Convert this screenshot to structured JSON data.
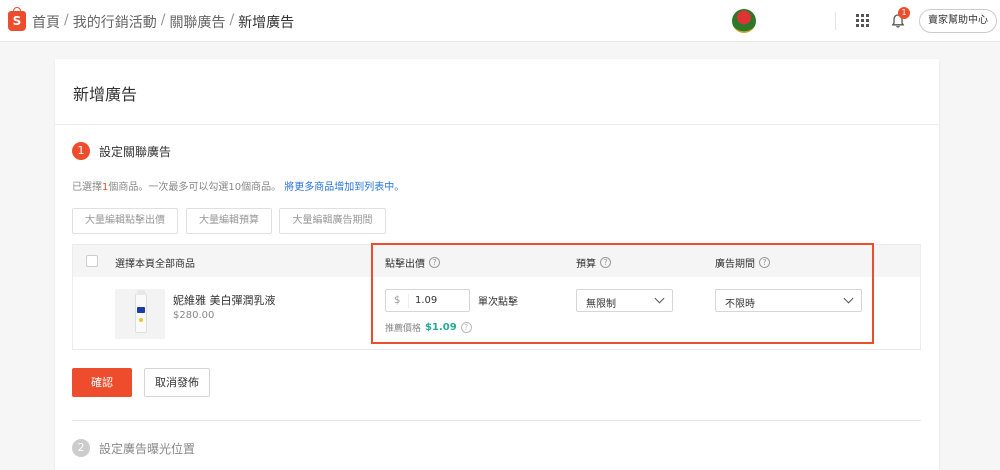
{
  "topbar": {
    "logo_letter": "S",
    "breadcrumb": [
      "首頁",
      "我的行銷活動",
      "關聯廣告",
      "新增廣告"
    ],
    "separator": "/",
    "notification_count": "1",
    "help_label": "賣家幫助中心"
  },
  "page": {
    "title": "新增廣告"
  },
  "step1": {
    "number": "1",
    "label": "設定關聯廣告",
    "selected_prefix": "已選擇",
    "selected_count": "1",
    "selected_suffix": "個商品。一次最多可以勾選10個商品。",
    "add_more_link": "將更多商品增加到列表中",
    "add_more_suffix": "。",
    "bulk_buttons": [
      "大量編輯點擊出價",
      "大量編輯預算",
      "大量編輯廣告期間"
    ]
  },
  "table": {
    "headers": {
      "select_all": "選擇本頁全部商品",
      "bid": "點擊出價",
      "budget": "預算",
      "period": "廣告期間"
    },
    "row": {
      "product_name": "妮維雅 美白彈潤乳液",
      "product_price": "$280.00",
      "bid_prefix": "$",
      "bid_value": "1.09",
      "per_click": "單次點擊",
      "suggested_label": "推薦價格",
      "suggested_value": "$1.09",
      "budget": "無限制",
      "period": "不限時"
    }
  },
  "actions": {
    "confirm": "確認",
    "cancel": "取消發佈"
  },
  "step2": {
    "number": "2",
    "label": "設定廣告曝光位置"
  },
  "colors": {
    "brand": "#ee4d2d",
    "link": "#2673dd",
    "suggested": "#26aa99"
  }
}
